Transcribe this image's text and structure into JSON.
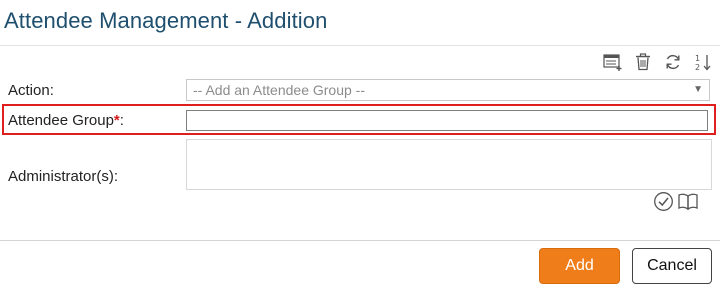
{
  "page": {
    "title": "Attendee Management - Addition"
  },
  "toolbar": {
    "icons": [
      "list-add-icon",
      "trash-icon",
      "refresh-icon",
      "sort-icon"
    ]
  },
  "form": {
    "action": {
      "label": "Action:",
      "selected": "-- Add an Attendee Group --"
    },
    "attendee_group": {
      "label": "Attendee Group",
      "required_mark": "*",
      "colon": ":",
      "value": ""
    },
    "administrators": {
      "label": "Administrator(s):",
      "tools": [
        "check-circle-icon",
        "book-icon"
      ]
    }
  },
  "footer": {
    "add_label": "Add",
    "cancel_label": "Cancel"
  },
  "colors": {
    "title": "#1f4f6e",
    "accent": "#ef7d1a",
    "highlight": "#e01e1e",
    "required": "#d21c1c"
  }
}
